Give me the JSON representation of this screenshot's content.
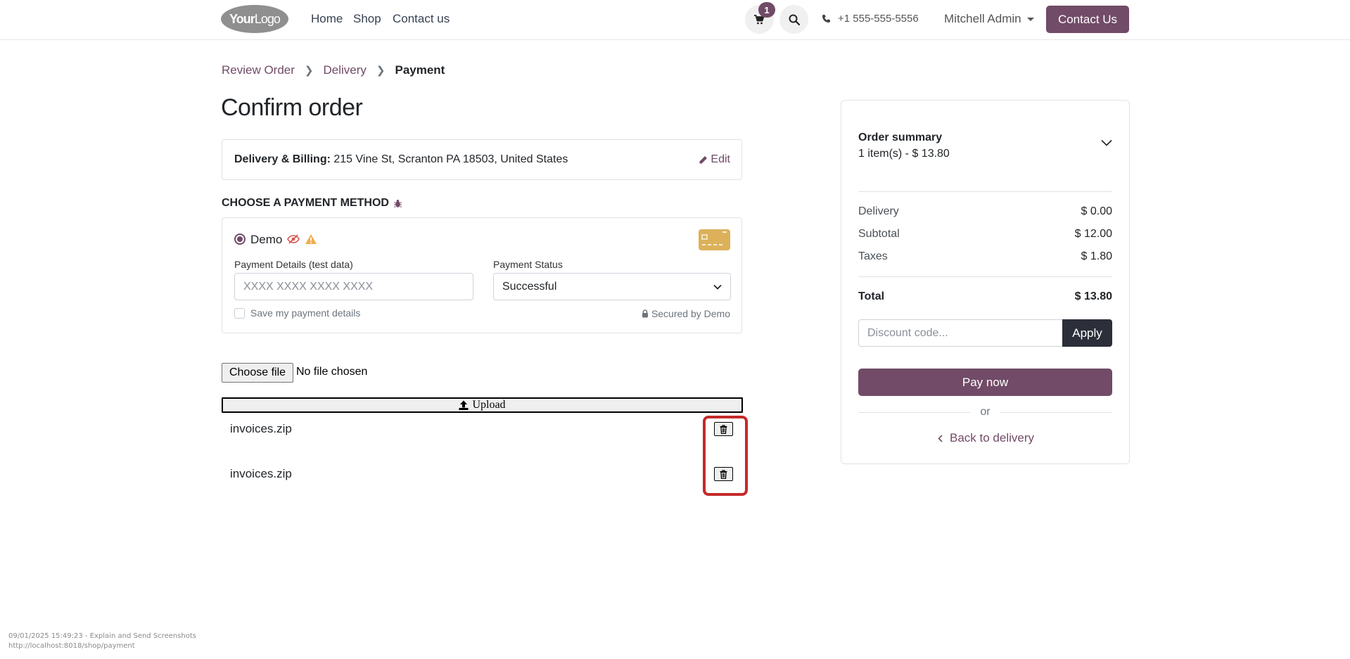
{
  "header": {
    "logo_text_bold": "Your",
    "logo_text_light": "Logo",
    "nav": [
      "Home",
      "Shop",
      "Contact us"
    ],
    "cart_count": "1",
    "phone": "+1 555-555-5556",
    "user": "Mitchell Admin",
    "contact_button": "Contact Us"
  },
  "breadcrumb": {
    "step1": "Review Order",
    "step2": "Delivery",
    "step3": "Payment"
  },
  "page_title": "Confirm order",
  "address": {
    "label": "Delivery & Billing:",
    "value": " 215 Vine St, Scranton PA 18503, United States",
    "edit": "Edit"
  },
  "payment": {
    "section_title": "CHOOSE A PAYMENT METHOD",
    "method_name": "Demo",
    "details_label": "Payment Details (test data)",
    "details_placeholder": "XXXX XXXX XXXX XXXX",
    "status_label": "Payment Status",
    "status_value": "Successful",
    "save_label": "Save my payment details",
    "secured": "Secured by Demo"
  },
  "upload": {
    "choose_file": "Choose file",
    "file_status": "No file chosen",
    "upload_label": "Upload",
    "files": [
      "invoices.zip",
      "invoices.zip"
    ]
  },
  "summary": {
    "title": "Order summary",
    "items": "1 item(s) -  $ 13.80",
    "lines": [
      {
        "label": "Delivery",
        "value": "$ 0.00"
      },
      {
        "label": "Subtotal",
        "value": "$ 12.00"
      },
      {
        "label": "Taxes",
        "value": "$ 1.80"
      }
    ],
    "total_label": "Total",
    "total_value": "$ 13.80",
    "discount_placeholder": "Discount code...",
    "apply": "Apply",
    "pay_now": "Pay now",
    "or": "or",
    "back": "Back to delivery"
  },
  "footer": {
    "timestamp": "09/01/2025 15:49:23 - Explain and Send Screenshots",
    "url": "http://localhost:8018/shop/payment"
  },
  "colors": {
    "brand": "#714b67",
    "dark_button": "#2c2f3a",
    "highlight": "#c42a2a",
    "warning": "#f0ad4e"
  }
}
